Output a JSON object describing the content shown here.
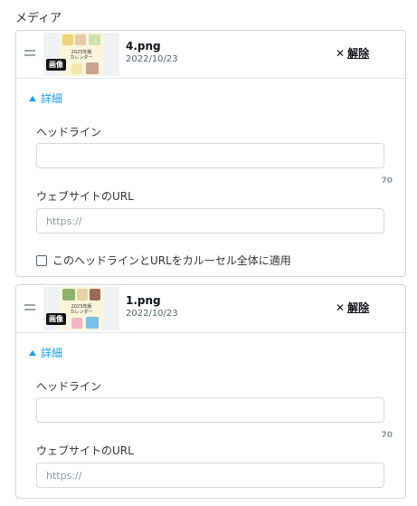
{
  "section_title": "メディア",
  "cards": [
    {
      "tag": "画像",
      "thumb_caption": [
        "2023年版",
        "カレンダー"
      ],
      "filename": "4.png",
      "date": "2022/10/23",
      "remove_icon": "close-icon",
      "remove_label": "解除",
      "details_label": "詳細",
      "headline_label": "ヘッドライン",
      "headline_value": "",
      "counter": "70",
      "url_label": "ウェブサイトのURL",
      "url_placeholder": "https://",
      "apply_all_label": "このヘッドラインとURLをカルーセル全体に適用"
    },
    {
      "tag": "画像",
      "thumb_caption": [
        "2023年版",
        "カレンダー"
      ],
      "filename": "1.png",
      "date": "2022/10/23",
      "remove_icon": "close-icon",
      "remove_label": "解除",
      "details_label": "詳細",
      "headline_label": "ヘッドライン",
      "headline_value": "",
      "counter": "70",
      "url_label": "ウェブサイトのURL",
      "url_placeholder": "https://"
    }
  ],
  "colors": {
    "accent": "#1d9bf0",
    "border": "#cfd9de",
    "muted": "#8899a6"
  }
}
